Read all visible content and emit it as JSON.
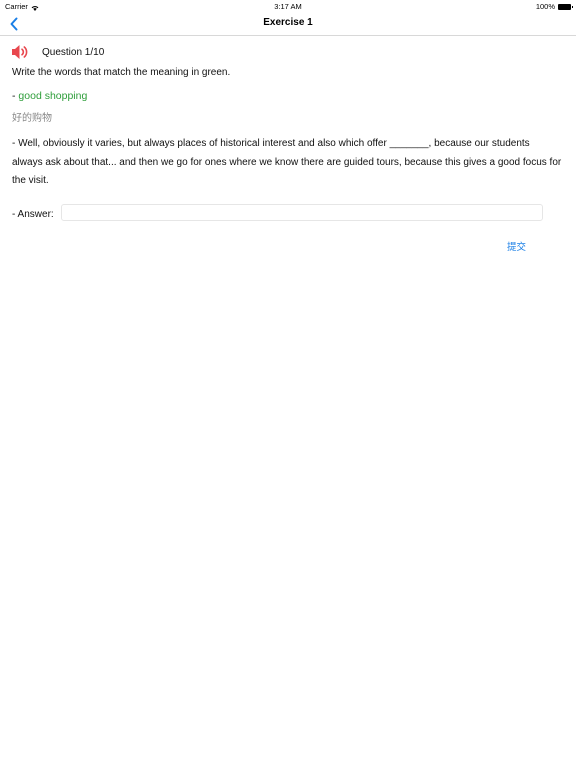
{
  "status_bar": {
    "carrier": "Carrier",
    "time": "3:17 AM",
    "battery": "100%",
    "icons": [
      "wifi-icon",
      "battery-icon"
    ]
  },
  "nav": {
    "title": "Exercise 1",
    "back_icon": "chevron-left-icon"
  },
  "question": {
    "speaker_icon": "speaker-icon",
    "label": "Question 1/10",
    "instruction": "Write the words that match the meaning in green.",
    "green_prefix": "- ",
    "green_text": "good shopping",
    "translation": "好的购物",
    "sentence": "- Well, obviously it varies, but always places of historical interest and also which offer _______, because our students always ask about that... and then we go for ones where we know there are guided tours, because this gives a good focus for the visit."
  },
  "answer": {
    "label": "- Answer:",
    "value": "",
    "placeholder": ""
  },
  "submit_label": "提交",
  "colors": {
    "accent": "#1a7fe6",
    "green": "#2e9e3a",
    "speaker": "#e8474e",
    "muted": "#8a8a8a"
  }
}
